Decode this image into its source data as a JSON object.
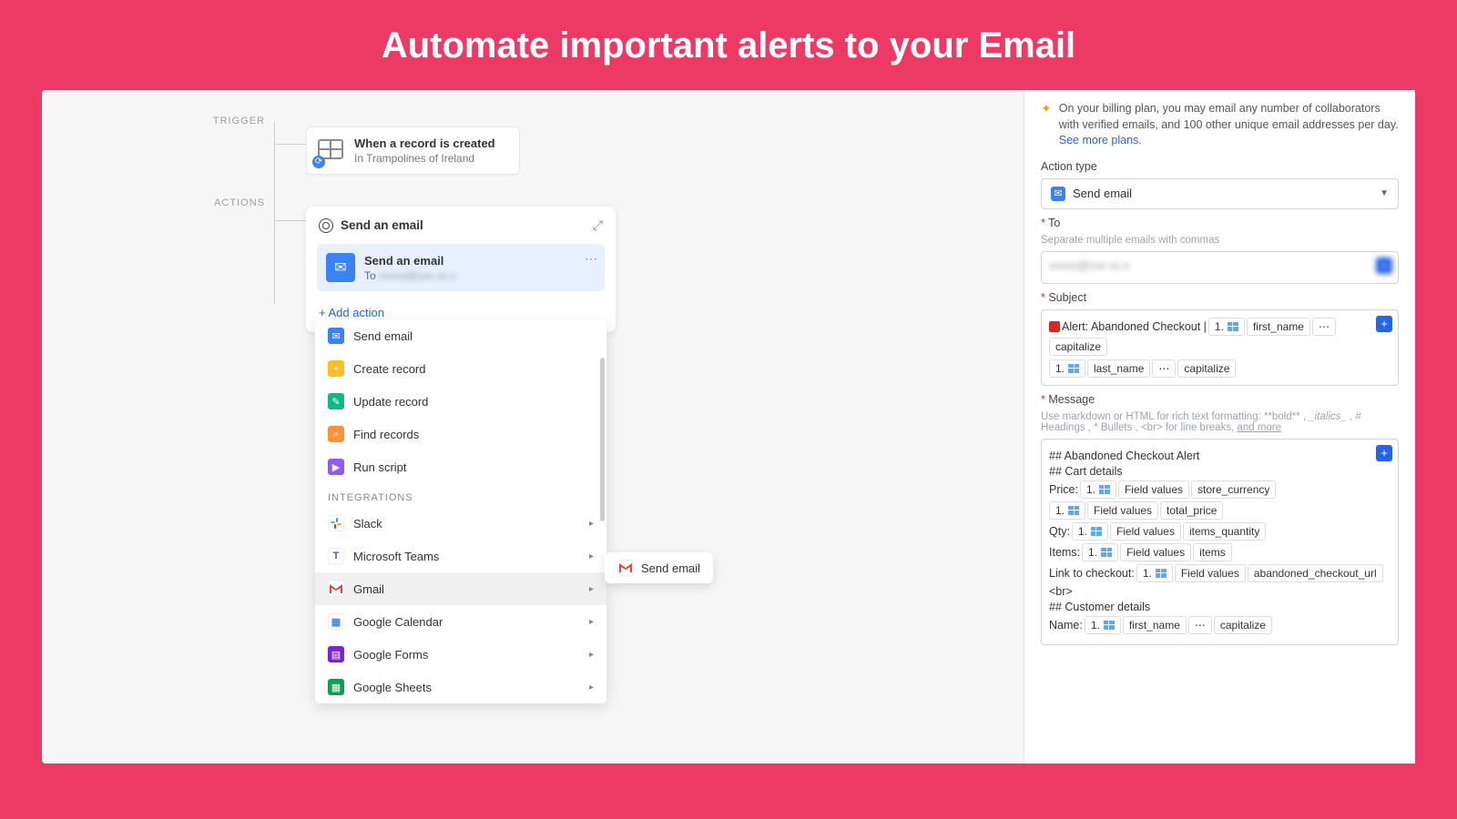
{
  "hero": {
    "title": "Automate important alerts to your Email"
  },
  "labels": {
    "trigger": "TRIGGER",
    "actions": "ACTIONS"
  },
  "trigger": {
    "title": "When a record is created",
    "subtitle": "In Trampolines of Ireland"
  },
  "action_panel": {
    "title": "Send an email",
    "current_title": "Send an email",
    "current_to_label": "To",
    "current_to_value": "xxxxx@xxx xx.x",
    "add_action": "Add action"
  },
  "dropdown": {
    "items": [
      {
        "icon": "blue",
        "glyph": "✉",
        "label": "Send email"
      },
      {
        "icon": "yel",
        "glyph": "+",
        "label": "Create record"
      },
      {
        "icon": "grn",
        "glyph": "✎",
        "label": "Update record"
      },
      {
        "icon": "org",
        "glyph": "🔍",
        "label": "Find records"
      },
      {
        "icon": "pur",
        "glyph": "▶",
        "label": "Run script"
      }
    ],
    "section": "INTEGRATIONS",
    "integrations": [
      {
        "key": "slack",
        "label": "Slack"
      },
      {
        "key": "teams",
        "label": "Microsoft Teams"
      },
      {
        "key": "gmail",
        "label": "Gmail",
        "highlighted": true
      },
      {
        "key": "gcal",
        "label": "Google Calendar"
      },
      {
        "key": "gform",
        "label": "Google Forms"
      },
      {
        "key": "gsheet",
        "label": "Google Sheets"
      }
    ]
  },
  "flyout": {
    "label": "Send email"
  },
  "right": {
    "banner": "On your billing plan, you may email any number of collaborators with verified emails, and 100 other unique email addresses per day.",
    "banner_link": "See more plans",
    "action_type_label": "Action type",
    "action_type_value": "Send email",
    "to_label": "To",
    "to_hint": "Separate multiple emails with commas",
    "to_value": "xxxxx@xxx xx.x",
    "subject_label": "Subject",
    "subject_prefix": "Alert: Abandoned Checkout |",
    "subject_tokens_row1": [
      "1.",
      "first_name",
      "⋯",
      "capitalize"
    ],
    "subject_tokens_row2": [
      "1.",
      "last_name",
      "⋯",
      "capitalize"
    ],
    "message_label": "Message",
    "message_hint1": "Use markdown or HTML for rich text formatting:",
    "message_hint_parts": [
      "**bold**",
      "_italics_",
      "# Headings",
      "* Bullets",
      "<br>",
      "for line breaks,"
    ],
    "message_hint_link": "and more",
    "msg": {
      "l1": "## Abandoned Checkout Alert",
      "l2": "## Cart details",
      "price": "Price:",
      "qty": "Qty:",
      "items": "Items:",
      "link": "Link to checkout:",
      "br": "<br>",
      "l3": "## Customer details",
      "name": "Name:"
    },
    "tok": {
      "one": "1.",
      "fv": "Field values",
      "store_currency": "store_currency",
      "total_price": "total_price",
      "items_quantity": "items_quantity",
      "items": "items",
      "acu": "abandoned_checkout_url",
      "first_name": "first_name",
      "dots": "⋯",
      "cap": "capitalize"
    }
  }
}
